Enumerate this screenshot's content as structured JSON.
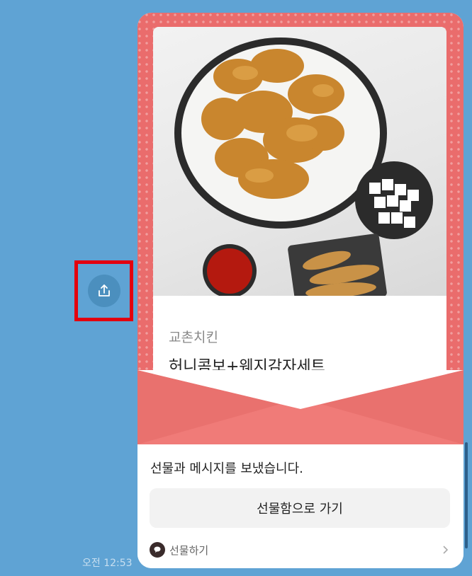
{
  "message": {
    "time": "오전 12:53"
  },
  "gift_card": {
    "brand": "교촌치킨",
    "product_name": "허니콤보+웨지감자세트",
    "sent_text": "선물과 메시지를 보냈습니다.",
    "go_button_label": "선물함으로 가기",
    "footer_label": "선물하기"
  },
  "icons": {
    "share": "share-icon",
    "chat": "chat-bubble-icon",
    "chevron": "chevron-right-icon"
  },
  "colors": {
    "chat_background": "#5fa3d4",
    "card_accent": "#ea6c6c",
    "highlight": "#e3000f"
  }
}
